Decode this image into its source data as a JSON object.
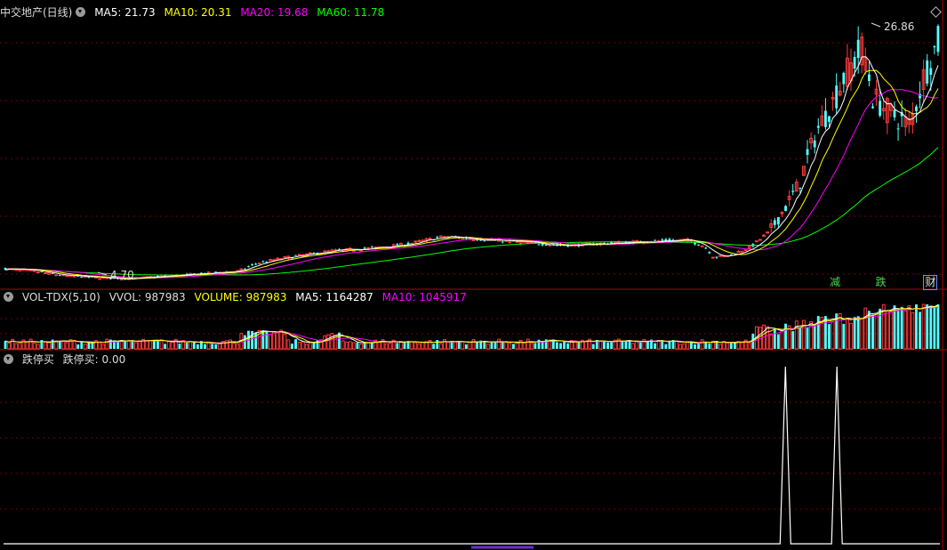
{
  "main": {
    "title": "中交地产(日线)",
    "ma5_label": "MA5: 21.73",
    "ma10_label": "MA10: 20.31",
    "ma20_label": "MA20: 19.68",
    "ma60_label": "MA60: 11.78",
    "high_label": "26.86",
    "low_label": "4.70",
    "tags": [
      {
        "text": "减",
        "color": "#4fd64f",
        "pos": 0.888
      },
      {
        "text": "跌",
        "color": "#4fd64f",
        "pos": 0.937
      },
      {
        "text": "财",
        "color": "#e0e0e0",
        "pos": 0.99
      }
    ]
  },
  "volume_panel": {
    "title": "VOL-TDX(5,10)",
    "vvol_label": "VVOL: 987983",
    "volume_label": "VOLUME: 987983",
    "ma5_label": "MA5: 1164287",
    "ma10_label": "MA10: 1045917"
  },
  "indicator_panel": {
    "title": "跌停买",
    "value_label": "跌停买: 0.00"
  },
  "colors": {
    "up": "#ff3c3c",
    "down": "#54ffff",
    "ma5": "#ffffff",
    "ma10": "#ffff00",
    "ma20": "#ff00ff",
    "ma60": "#00ff00",
    "grid": "#7a0000"
  },
  "chart_data": {
    "type": "candlestick",
    "high_annotation": 26.86,
    "low_annotation": 4.7,
    "ma_last": {
      "MA5": 21.73,
      "MA10": 20.31,
      "MA20": 19.68,
      "MA60": 11.78
    },
    "volume_last": {
      "VVOL": 987983,
      "MA5": 1164287,
      "MA10": 1045917
    },
    "indicator_last": {
      "跌停买": 0.0
    },
    "indicator_spikes_at_fraction": [
      0.835,
      0.89
    ],
    "price_keyframes": [
      [
        0,
        5.6
      ],
      [
        0.03,
        5.4
      ],
      [
        0.06,
        5.0
      ],
      [
        0.1,
        4.8
      ],
      [
        0.13,
        4.7
      ],
      [
        0.2,
        5.1
      ],
      [
        0.25,
        5.4
      ],
      [
        0.27,
        6.1
      ],
      [
        0.3,
        6.6
      ],
      [
        0.35,
        7.2
      ],
      [
        0.4,
        7.5
      ],
      [
        0.43,
        7.8
      ],
      [
        0.47,
        8.5
      ],
      [
        0.55,
        8.0
      ],
      [
        0.6,
        7.7
      ],
      [
        0.65,
        7.9
      ],
      [
        0.7,
        8.1
      ],
      [
        0.73,
        8.2
      ],
      [
        0.75,
        7.6
      ],
      [
        0.76,
        6.6
      ],
      [
        0.78,
        6.9
      ],
      [
        0.8,
        7.6
      ],
      [
        0.82,
        9.0
      ],
      [
        0.85,
        13.0
      ],
      [
        0.87,
        18.0
      ],
      [
        0.89,
        21.0
      ],
      [
        0.9,
        23.0
      ],
      [
        0.92,
        25.5
      ],
      [
        0.93,
        21.0
      ],
      [
        0.95,
        19.5
      ],
      [
        0.97,
        18.5
      ],
      [
        0.985,
        23.0
      ],
      [
        1.0,
        26.0
      ]
    ]
  }
}
